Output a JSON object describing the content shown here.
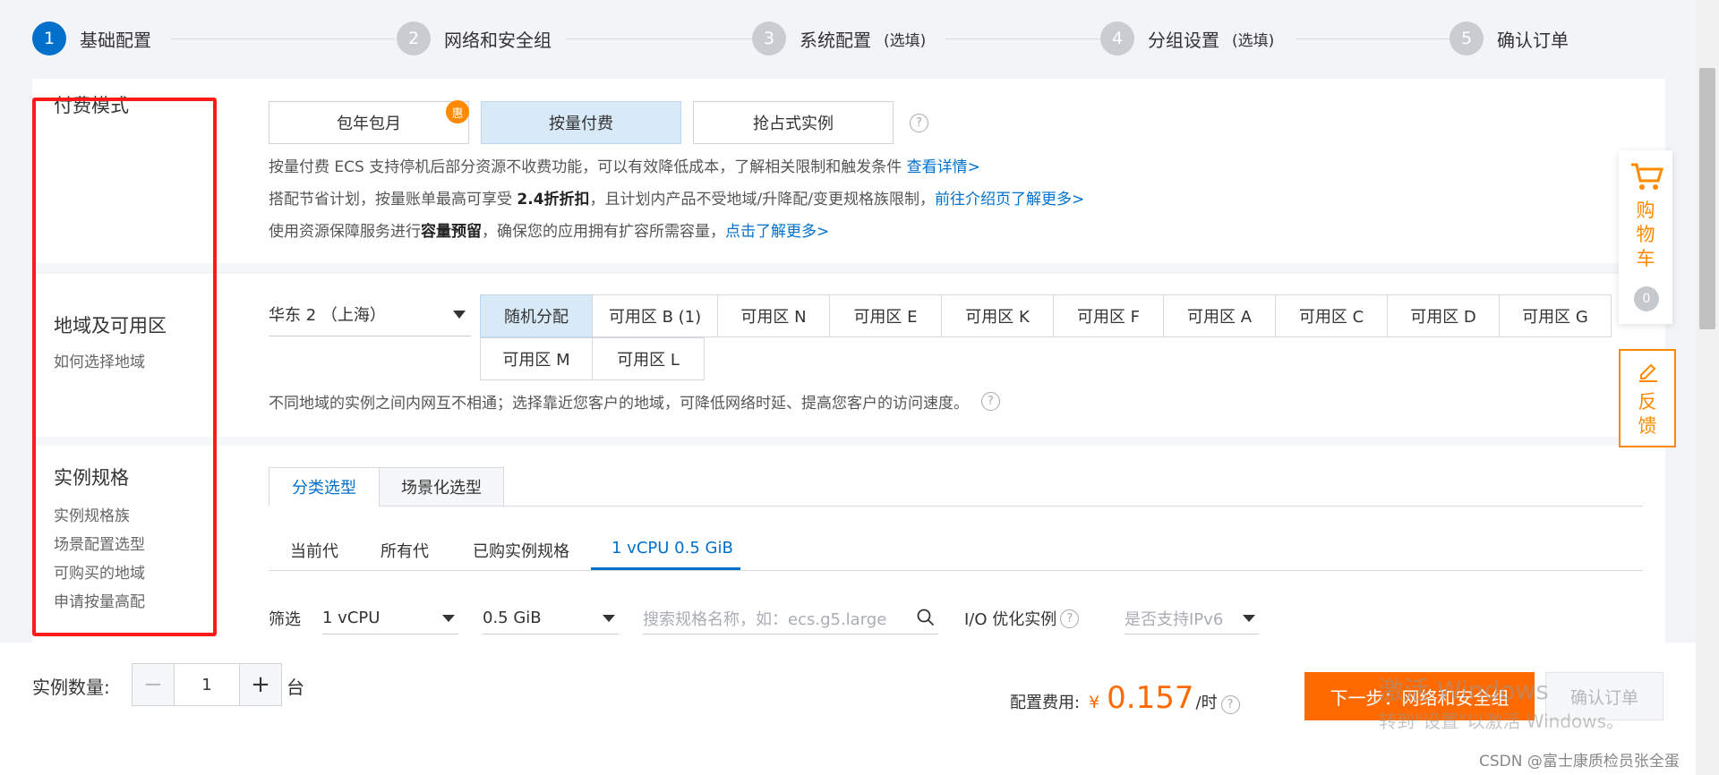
{
  "steps": [
    {
      "num": "1",
      "label": "基础配置",
      "optional": ""
    },
    {
      "num": "2",
      "label": "网络和安全组",
      "optional": ""
    },
    {
      "num": "3",
      "label": "系统配置",
      "optional": "(选填)"
    },
    {
      "num": "4",
      "label": "分组设置",
      "optional": "(选填)"
    },
    {
      "num": "5",
      "label": "确认订单",
      "optional": ""
    }
  ],
  "billing": {
    "title": "付费模式",
    "options": [
      {
        "label": "包年包月",
        "badge": "惠"
      },
      {
        "label": "按量付费"
      },
      {
        "label": "抢占式实例"
      }
    ],
    "help": "?",
    "desc1": "按量付费 ECS 支持停机后部分资源不收费功能，可以有效降低成本，了解相关限制和触发条件 ",
    "desc1_link": "查看详情>",
    "desc2_pre": "搭配节省计划，按量账单最高可享受 ",
    "desc2_bold": "2.4折折扣",
    "desc2_post": "，且计划内产品不受地域/升降配/变更规格族限制，",
    "desc2_link": "前往介绍页了解更多>",
    "desc3_pre": "使用资源保障服务进行",
    "desc3_bold": "容量预留",
    "desc3_post": "，确保您的应用拥有扩容所需容量，",
    "desc3_link": "点击了解更多>"
  },
  "region": {
    "title": "地域及可用区",
    "sub": "如何选择地域",
    "selected": "华东 2 （上海）",
    "zones": [
      "随机分配",
      "可用区 B (1)",
      "可用区 N",
      "可用区 E",
      "可用区 K",
      "可用区 F",
      "可用区 A",
      "可用区 C",
      "可用区 D",
      "可用区 G",
      "可用区 M",
      "可用区 L"
    ],
    "note": "不同地域的实例之间内网互不相通；选择靠近您客户的地域，可降低网络时延、提高您客户的访问速度。"
  },
  "instance": {
    "title": "实例规格",
    "links": [
      "实例规格族",
      "场景配置选型",
      "可购买的地域",
      "申请按量高配"
    ],
    "tabs": [
      "分类选型",
      "场景化选型"
    ],
    "subtabs": [
      "当前代",
      "所有代",
      "已购实例规格",
      "1 vCPU 0.5 GiB"
    ],
    "filter_label": "筛选",
    "cpu": "1 vCPU",
    "mem": "0.5 GiB",
    "search_placeholder": "搜索规格名称，如：ecs.g5.large",
    "io_label": "I/O 优化实例",
    "ipv6_placeholder": "是否支持IPv6"
  },
  "footer": {
    "qty_label": "实例数量:",
    "qty_minus": "−",
    "qty_value": "1",
    "qty_plus": "+",
    "qty_unit": "台",
    "cost_label": "配置费用:",
    "currency": "¥",
    "price": "0.157",
    "per": "/时",
    "next_btn": "下一步：网络和安全组",
    "confirm_btn": "确认订单"
  },
  "side": {
    "cart_chars": [
      "购",
      "物",
      "车"
    ],
    "cart_count": "0",
    "feedback_chars": [
      "反",
      "馈"
    ]
  },
  "watermark": {
    "line1": "激活 Windows",
    "line2": "转到\"设置\"以激活 Windows。",
    "credit": "CSDN @富士康质检员张全蛋"
  },
  "colors": {
    "accent": "#0070cc",
    "orange": "#ff6a00",
    "highlight": "#d8e9f8",
    "border_red": "#ff1a1a"
  }
}
